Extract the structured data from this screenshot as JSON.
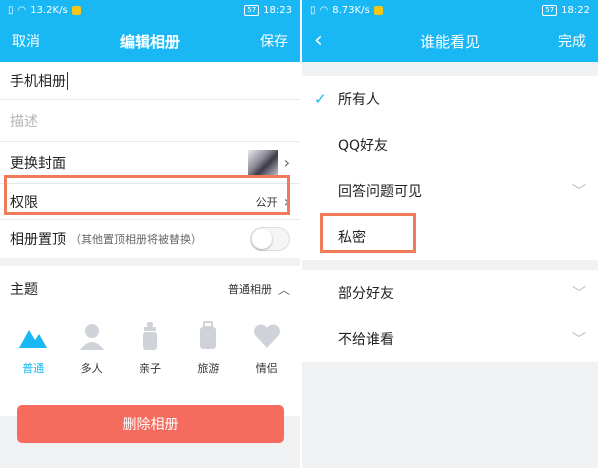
{
  "left": {
    "status": {
      "speed": "13.2K/s",
      "battery": "57",
      "time": "18:23"
    },
    "nav": {
      "cancel": "取消",
      "title": "编辑相册",
      "save": "保存"
    },
    "album_name": "手机相册",
    "description_placeholder": "描述",
    "change_cover_label": "更换封面",
    "permission_label": "权限",
    "permission_value": "公开",
    "pin_label": "相册置顶",
    "pin_hint": "（其他置顶相册将被替换）",
    "pin_enabled": false,
    "theme": {
      "label": "主题",
      "value": "普通相册",
      "options": [
        {
          "label": "普通",
          "icon": "mountain-icon",
          "active": true
        },
        {
          "label": "多人",
          "icon": "person-icon",
          "active": false
        },
        {
          "label": "亲子",
          "icon": "baby-bottle-icon",
          "active": false
        },
        {
          "label": "旅游",
          "icon": "suitcase-icon",
          "active": false
        },
        {
          "label": "情侣",
          "icon": "heart-icon",
          "active": false
        }
      ]
    },
    "delete_label": "删除相册"
  },
  "right": {
    "status": {
      "speed": "8.73K/s",
      "battery": "57",
      "time": "18:22"
    },
    "nav": {
      "title": "谁能看见",
      "done": "完成"
    },
    "options_group1": [
      {
        "label": "所有人",
        "checked": true,
        "expandable": false
      },
      {
        "label": "QQ好友",
        "checked": false,
        "expandable": false
      },
      {
        "label": "回答问题可见",
        "checked": false,
        "expandable": true
      },
      {
        "label": "私密",
        "checked": false,
        "expandable": false
      }
    ],
    "options_group2": [
      {
        "label": "部分好友",
        "expandable": true
      },
      {
        "label": "不给谁看",
        "expandable": true
      }
    ]
  },
  "colors": {
    "accent": "#19b8f4",
    "highlight": "#ef7b58",
    "delete": "#f56b5e"
  }
}
